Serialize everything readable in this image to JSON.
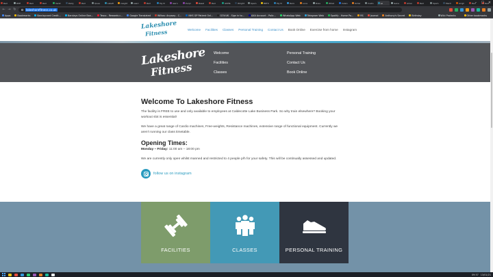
{
  "browser": {
    "tabs": [
      {
        "label": "Red ",
        "color": "#c0392b"
      },
      {
        "label": "RDE ",
        "color": "#95a5a6"
      },
      {
        "label": "Red ",
        "color": "#c0392b"
      },
      {
        "label": "Red ",
        "color": "#c0392b"
      },
      {
        "label": "Verst",
        "color": "#27ae60"
      },
      {
        "label": "Daily",
        "color": "#34495e"
      },
      {
        "label": "Red ",
        "color": "#c0392b"
      },
      {
        "label": "Quee",
        "color": "#7f8c8d"
      },
      {
        "label": "Lakefi",
        "color": "#2e8fb0"
      },
      {
        "label": "insight",
        "color": "#f39c12"
      },
      {
        "label": "searc",
        "color": "#95a5a6"
      },
      {
        "label": "Red ",
        "color": "#c0392b"
      },
      {
        "label": "My N",
        "color": "#2980b9"
      },
      {
        "label": "learn",
        "color": "#8e44ad"
      },
      {
        "label": "Purpl",
        "color": "#8e44ad"
      },
      {
        "label": "Reset",
        "color": "#e74c3c"
      },
      {
        "label": "Red ",
        "color": "#c0392b"
      },
      {
        "label": "GINTe",
        "color": "#16a085"
      },
      {
        "label": "Wright",
        "color": "#2c3e50"
      },
      {
        "label": "Spam",
        "color": "#7f8c8d"
      },
      {
        "label": "BRTK",
        "color": "#f1c40f"
      },
      {
        "label": "My N",
        "color": "#2980b9"
      },
      {
        "label": "Raini",
        "color": "#3498db"
      },
      {
        "label": "Loca",
        "color": "#e67e22"
      },
      {
        "label": "Ross",
        "color": "#95a5a6"
      },
      {
        "label": "What",
        "color": "#27ae60"
      },
      {
        "label": "Calen",
        "color": "#1a73e8"
      },
      {
        "label": "Order",
        "color": "#e67e22"
      },
      {
        "label": "Custo",
        "color": "#7f8c8d"
      },
      {
        "label": "Lo",
        "color": "#2e8fb0",
        "active": true
      },
      {
        "label": "Gene",
        "color": "#95a5a6"
      },
      {
        "label": "Amer",
        "color": "#c0392b"
      },
      {
        "label": "Red ",
        "color": "#c0392b"
      },
      {
        "label": "Spam",
        "color": "#7f8c8d"
      },
      {
        "label": "Mech",
        "color": "#34495e"
      },
      {
        "label": "Arrgh",
        "color": "#d35400"
      },
      {
        "label": "Red ",
        "color": "#c0392b"
      },
      {
        "label": "Red ",
        "color": "#c0392b"
      },
      {
        "label": "Red ",
        "color": "#c0392b"
      },
      {
        "label": "Red ",
        "color": "#c0392b"
      },
      {
        "label": "Subsc",
        "color": "#7f8c8d"
      }
    ],
    "url": "lakeshorefitness.co.uk",
    "bookmarks": [
      {
        "label": "Apps",
        "color": "#4285f4"
      },
      {
        "label": "Bookmarks",
        "color": "#fbbc05"
      },
      {
        "label": "Barclaycard Credit...",
        "color": "#00aeef"
      },
      {
        "label": "Barclays Online Ban...",
        "color": "#00aeef"
      },
      {
        "label": "Tesco - Rewards c...",
        "color": "#ee1c2e"
      },
      {
        "label": "Google Translated",
        "color": "#4285f4"
      },
      {
        "label": "Wilkos: Anyway - C...",
        "color": "#c0392b"
      },
      {
        "label": "NHS GP Patient Onl...",
        "color": "#005eb8"
      },
      {
        "label": "GOV.UK - Sign in to...",
        "color": "#222222"
      },
      {
        "label": "AXA Account - Polic...",
        "color": "#00008f"
      },
      {
        "label": "WhatsApp Web",
        "color": "#25d366"
      },
      {
        "label": "Telegram Web",
        "color": "#2aa1da"
      },
      {
        "label": "Spotify - Home Pa...",
        "color": "#1db954"
      },
      {
        "label": "RS",
        "color": "#f39c12"
      },
      {
        "label": "Journal",
        "color": "#e74c3c"
      },
      {
        "label": "Anthony's Secret",
        "color": "#e67e22"
      },
      {
        "label": "Birthday",
        "color": "#f1c40f"
      }
    ],
    "bookmarks_right": [
      {
        "label": "Wiki Protects",
        "color": "#95a5a6"
      },
      {
        "label": "Other bookmarks",
        "color": "#fbbc05"
      }
    ],
    "ext_colors": [
      "#e74c3c",
      "#27ae60",
      "#3498db",
      "#f39c12",
      "#9b59b6",
      "#1abc9c",
      "#e67e22",
      "#95a5a6"
    ]
  },
  "site": {
    "logo_line1": "Lakeshore",
    "logo_line2": "Fitness",
    "nav": [
      {
        "label": "Welcome"
      },
      {
        "label": "Facilities"
      },
      {
        "label": "Classes"
      },
      {
        "label": "Personal Training"
      },
      {
        "label": "Contact Us"
      },
      {
        "label": "Book Online"
      },
      {
        "label": "Exercise from home"
      },
      {
        "label": "Instagram"
      }
    ],
    "footer_col1": [
      "Welcome",
      "Facilities",
      "Classes"
    ],
    "footer_col2": [
      "Personal Training",
      "Contact Us",
      "Book Online"
    ],
    "colors": {
      "accent": "#2a9bbf",
      "dark_band": "#525458",
      "feature_band": "#7392a8"
    }
  },
  "content": {
    "title": "Welcome To Lakeshore Fitness",
    "para1": "The facility is FREE to use and only available to employees at Caldecotte Lake Business Park. So why train elsewhere? Booking your workout slot is essential!",
    "para2": "We have a great range of Cardio machines, Free-weights, Resistance machines, extensive range of functional equipment. Currently we aren't running our class timetable.",
    "opening_title": "Opening Times:",
    "hours_days": "Monday – Friday:",
    "hours_time": " 11:00 am – 18:00 pm",
    "para3": "We are currently only open whilst manned and restricted to 4 people p/h for your safety. This will be continually assessed and updated.",
    "instagram_link": "follow us on instagram"
  },
  "tiles": [
    {
      "label": "FACILITIES",
      "icon": "dumbbell-icon",
      "color": "#7e9c6b"
    },
    {
      "label": "CLASSES",
      "icon": "group-icon",
      "color": "#4399b6"
    },
    {
      "label": "PERSONAL TRAINING",
      "icon": "sneaker-icon",
      "color": "#2f3540"
    }
  ],
  "taskbar": {
    "app_colors": [
      "#f1c40f",
      "#e74c3c",
      "#3498db",
      "#2ecc71",
      "#9b59b6",
      "#e67e22",
      "#1abc9c",
      "#ecf0f1"
    ],
    "time": "09:57",
    "date": "13/01/21"
  }
}
